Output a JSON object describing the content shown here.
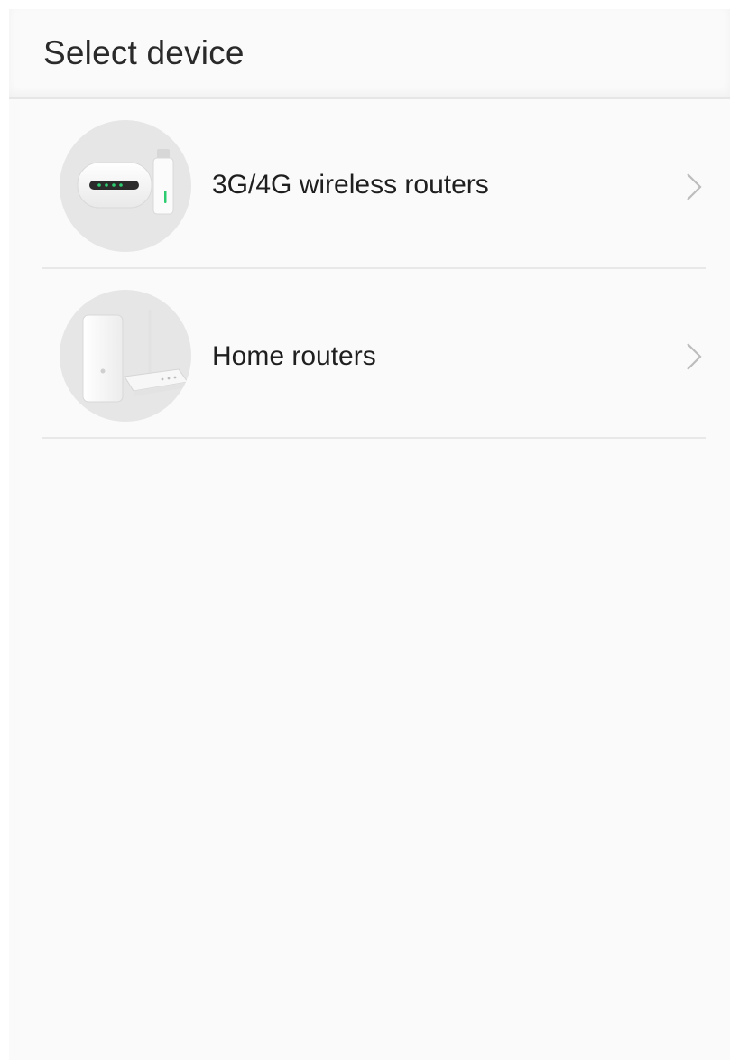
{
  "header": {
    "title": "Select device"
  },
  "devices": [
    {
      "label": "3G/4G wireless routers",
      "icon": "mobile-router-icon"
    },
    {
      "label": "Home routers",
      "icon": "home-router-icon"
    }
  ],
  "colors": {
    "background": "#fafafa",
    "text": "#1f1f1f",
    "divider": "#e8e8e8",
    "avatar_bg": "#e6e6e6",
    "chevron": "#bdbdbd",
    "status_led": "#2ecc71"
  }
}
